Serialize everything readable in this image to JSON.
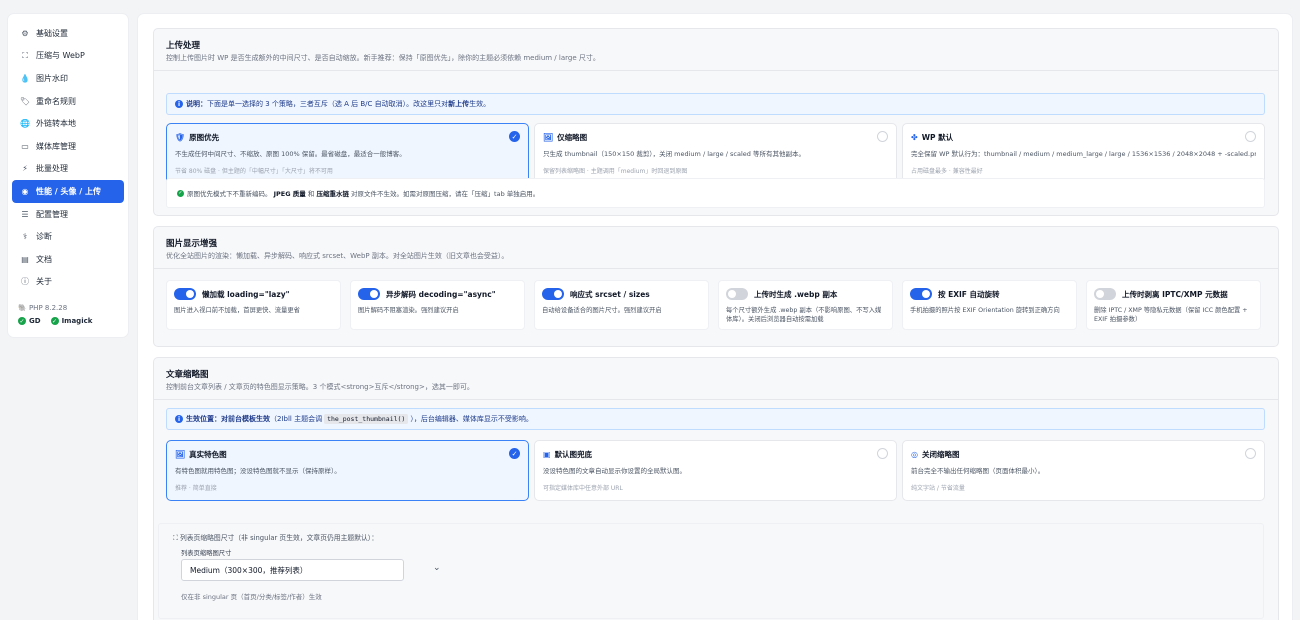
{
  "sidebar": {
    "items": [
      {
        "label": "基础设置",
        "icon": "gear-icon",
        "glyph": "⚙"
      },
      {
        "label": "压缩与 WebP",
        "icon": "compress-icon",
        "glyph": "⛶"
      },
      {
        "label": "图片水印",
        "icon": "droplet-icon",
        "glyph": "💧"
      },
      {
        "label": "重命名规则",
        "icon": "tag-icon",
        "glyph": "🏷"
      },
      {
        "label": "外链转本地",
        "icon": "globe-icon",
        "glyph": "🌐"
      },
      {
        "label": "媒体库管理",
        "icon": "media-icon",
        "glyph": "▭"
      },
      {
        "label": "批量处理",
        "icon": "bolt-icon",
        "glyph": "⚡"
      },
      {
        "label": "性能 / 头像 / 上传",
        "icon": "speed-icon",
        "glyph": "◉"
      },
      {
        "label": "配置管理",
        "icon": "database-icon",
        "glyph": "☰"
      },
      {
        "label": "诊断",
        "icon": "stethoscope-icon",
        "glyph": "⚕"
      },
      {
        "label": "文档",
        "icon": "book-icon",
        "glyph": "▤"
      },
      {
        "label": "关于",
        "icon": "info-icon",
        "glyph": "ⓘ"
      }
    ],
    "active_index": 7,
    "php_version": "PHP 8.2.28",
    "ext_gd": "GD",
    "ext_imagick": "Imagick"
  },
  "upload": {
    "title": "上传处理",
    "desc": "控制上传图片时 WP 是否生成额外的中间尺寸、是否自动缩放。新手推荐：保持「原图优先」，除你的主题必须依赖 medium / large 尺寸。",
    "info_prefix": "说明：",
    "info_text_1": "下面是单一选择的 3 个策略，三者互斥（选 A 后 B/C 自动取消）。改这里只对",
    "info_strong": "新上传",
    "info_text_2": "生效。",
    "cards": [
      {
        "title": "原图优先",
        "icon": "shield-icon",
        "glyph": "🛡",
        "desc": "不生成任何中间尺寸、不缩放、原图 100% 保留。最省磁盘，最适合一般博客。",
        "note": "节省 80% 磁盘 · 但主题的「中幅尺寸」「大尺寸」将不可用",
        "selected": true
      },
      {
        "title": "仅缩略图",
        "icon": "image-icon",
        "glyph": "🖼",
        "desc": "只生成 thumbnail（150×150 裁剪），关闭 medium / large / scaled 等所有其他副本。",
        "note": "保留列表缩略图 · 主题调用「medium」时回退到原图",
        "selected": false
      },
      {
        "title": "WP 默认",
        "icon": "wordpress-icon",
        "glyph": "✤",
        "desc": "完全保留 WP 默认行为：thumbnail / medium / medium_large / large / 1536×1536 / 2048×2048 + -scaled.png。",
        "note": "占用磁盘最多 · 兼容性最好",
        "selected": false
      }
    ],
    "note_1": "原图优先模式下不重新编码。",
    "note_b1": "JPEG 质量",
    "note_mid": "和",
    "note_b2": "压缩重水链",
    "note_2": "对原文件不生效。如需对原图压缩，请在「压缩」tab 单独启用。"
  },
  "display": {
    "title": "图片显示增强",
    "desc": "优化全站图片的渲染：懒加载、异步解码、响应式 srcset、WebP 副本。对全站图片生效（旧文章也会受益）。",
    "toggles": [
      {
        "label": "懒加载 loading=\"lazy\"",
        "desc": "图片进入视口前不加载，首屏更快、流量更省",
        "on": true
      },
      {
        "label": "异步解码 decoding=\"async\"",
        "desc": "图片解码不阻塞渲染。强烈建议开启",
        "on": true
      },
      {
        "label": "响应式 srcset / sizes",
        "desc": "自动给设备适合的图片尺寸。强烈建议开启",
        "on": true
      },
      {
        "label": "上传时生成 .webp 副本",
        "desc": "每个尺寸额外生成 .webp 副本（不影响原图、不写入媒体库）。关闭后浏览器自动按需加载",
        "on": false
      },
      {
        "label": "按 EXIF 自动旋转",
        "desc": "手机拍摄的照片按 EXIF Orientation 旋转到正确方向",
        "on": true
      },
      {
        "label": "上传时剥离 IPTC/XMP 元数据",
        "desc": "删除 IPTC / XMP 等隐私元数据（保留 ICC 颜色配置 + EXIF 拍摄参数）",
        "on": false
      }
    ]
  },
  "thumb": {
    "title": "文章缩略图",
    "desc": "控制前台文章列表 / 文章页的特色图显示策略。3 个模式<strong>互斥</strong>，选其一即可。",
    "info_prefix": "生效位置：",
    "info_strong": "对前台模板生效",
    "info_text_1": "（2Ibll 主题会调",
    "info_code": "the_post_thumbnail()",
    "info_text_2": "），后台编辑器、媒体库显示不受影响。",
    "cards": [
      {
        "title": "真实特色图",
        "icon": "image-icon",
        "glyph": "🖼",
        "desc": "有特色图就用特色图；没设特色图就不显示（保持原样）。",
        "note": "推荐 · 简单直接",
        "selected": true
      },
      {
        "title": "默认图兜底",
        "icon": "file-icon",
        "glyph": "▣",
        "desc": "没设特色图的文章自动显示你设置的全局默认图。",
        "note": "可指定媒体库中任意外部 URL",
        "selected": false
      },
      {
        "title": "关闭缩略图",
        "icon": "eye-off-icon",
        "glyph": "◎",
        "desc": "前台完全不输出任何缩略图（页面体积最小）。",
        "note": "纯文字站 / 节省流量",
        "selected": false
      }
    ],
    "sub_heading": "列表页缩略图尺寸（非 singular 页生效，文章页仍用主题默认）：",
    "sub_label": "列表页缩略图尺寸",
    "select_value": "Medium（300×300，推荐列表）",
    "sub_hint": "仅在非 singular 页（首页/分类/标签/作者）生效"
  }
}
